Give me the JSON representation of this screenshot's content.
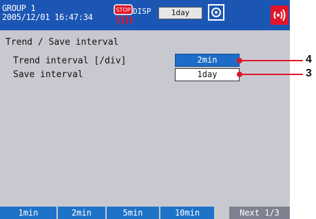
{
  "header": {
    "group": "GROUP 1",
    "datetime": "2005/12/01 16:47:34",
    "stop_icon": "stop-icon",
    "disp_label": "DISP",
    "time_div": "1day",
    "memory_icon": "memory-icon",
    "alarm_icon": "alarm-sound-icon",
    "colors": {
      "header_bg": "#1c56b4",
      "alarm_bg": "#e0152a"
    }
  },
  "screen_title": "Trend / Save interval",
  "settings": {
    "trend_interval": {
      "label": "Trend interval [/div]",
      "value": "2min"
    },
    "save_interval": {
      "label": "Save interval",
      "value": "1day"
    }
  },
  "softkeys": [
    "1min",
    "2min",
    "5min",
    "10min"
  ],
  "softkey_next": "Next 1/3",
  "callouts": {
    "trend": "4",
    "save": "3",
    "color": "#e0152a"
  },
  "colors": {
    "screen_bg": "#c8c9d0",
    "selected_bg": "#1d6cc7",
    "softkey_bg": "#1e73c8"
  }
}
